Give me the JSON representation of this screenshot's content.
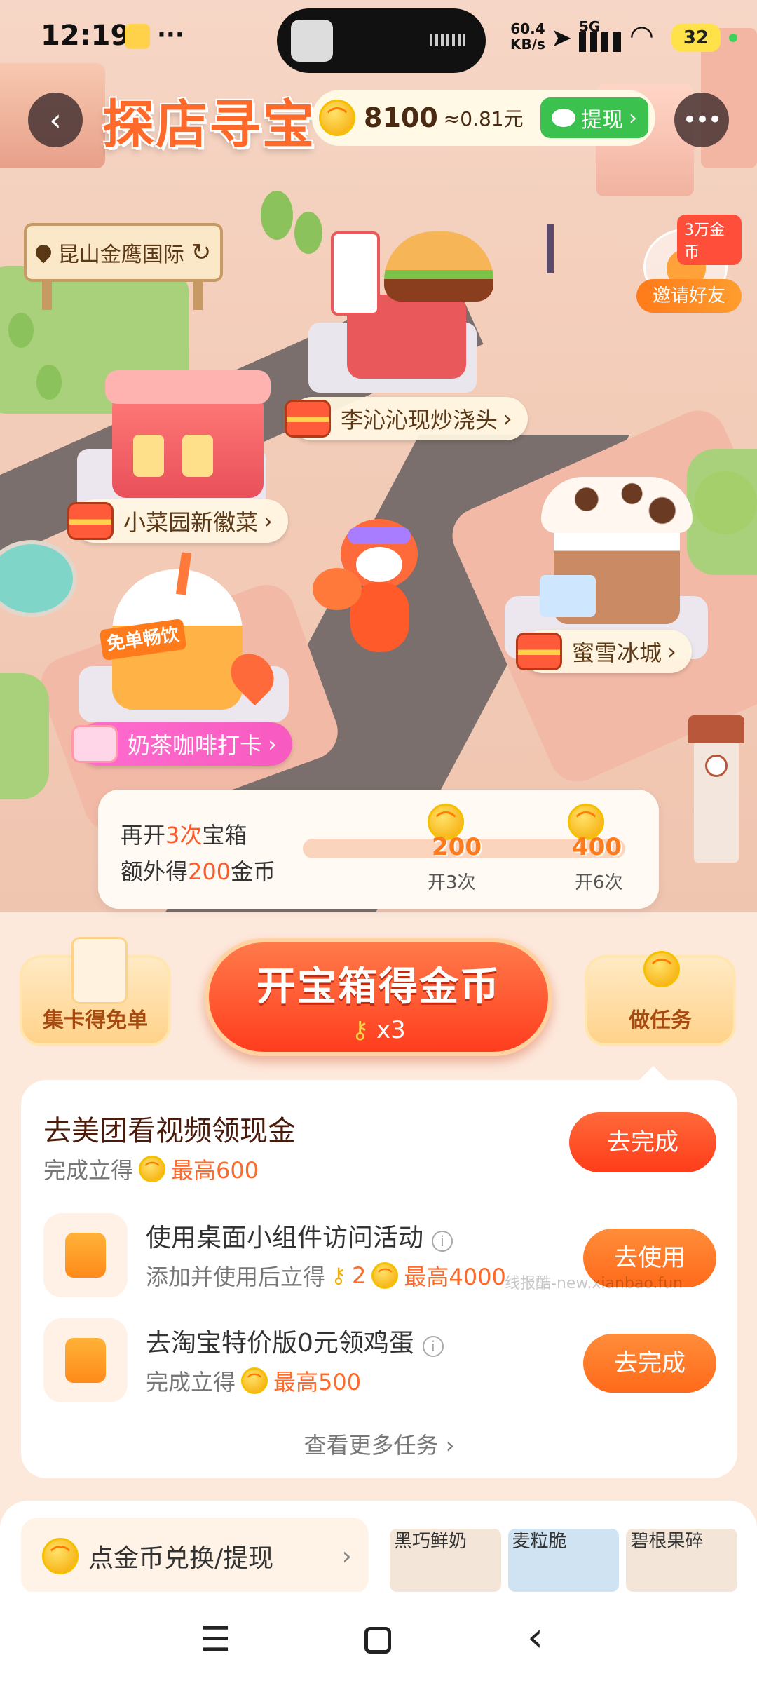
{
  "status": {
    "time": "12:19",
    "net_speed": "60.4\nKB/s",
    "network": "5G",
    "battery": "32"
  },
  "header": {
    "title": "探店寻宝",
    "coins": "8100",
    "approx": "≈0.81元",
    "withdraw_label": "提现"
  },
  "location": {
    "name": "昆山金鹰国际"
  },
  "invite": {
    "badge": "3万金币",
    "label": "邀请好友"
  },
  "shops": [
    {
      "name": "李沁沁现炒浇头"
    },
    {
      "name": "小菜园新徽菜"
    },
    {
      "name": "蜜雪冰城"
    },
    {
      "name": "奶茶咖啡打卡"
    }
  ],
  "sign_free": "免单畅饮",
  "progress": {
    "line1_a": "再开",
    "line1_b": "3次",
    "line1_c": "宝箱",
    "line2_a": "额外得",
    "line2_b": "200",
    "line2_c": "金币",
    "milestones": [
      {
        "coins": "200",
        "label": "开3次"
      },
      {
        "coins": "400",
        "label": "开6次"
      }
    ],
    "progress_fraction": 0
  },
  "actions": {
    "collect_cards": "集卡得免单",
    "open_chest": "开宝箱得金币",
    "keys": "x3",
    "tasks": "做任务"
  },
  "tasks": {
    "main": {
      "title": "去美团看视频领现金",
      "sub": "完成立得",
      "reward": "最高600",
      "button": "去完成"
    },
    "items": [
      {
        "name": "使用桌面小组件访问活动",
        "sub": "添加并使用后立得",
        "keys": "2",
        "reward": "最高4000",
        "button": "去使用"
      },
      {
        "name": "去淘宝特价版0元领鸡蛋",
        "sub": "完成立得",
        "reward": "最高500",
        "button": "去完成"
      }
    ],
    "more": "查看更多任务"
  },
  "watermark": "线报酷-new.xianbao.fun",
  "bottom": {
    "exchange": "点金币兑换/提现",
    "products": [
      "黑巧鲜奶",
      "麦粒脆",
      "碧根果碎"
    ]
  },
  "colors": {
    "accent": "#ff5a2a",
    "green": "#3bc24e"
  }
}
